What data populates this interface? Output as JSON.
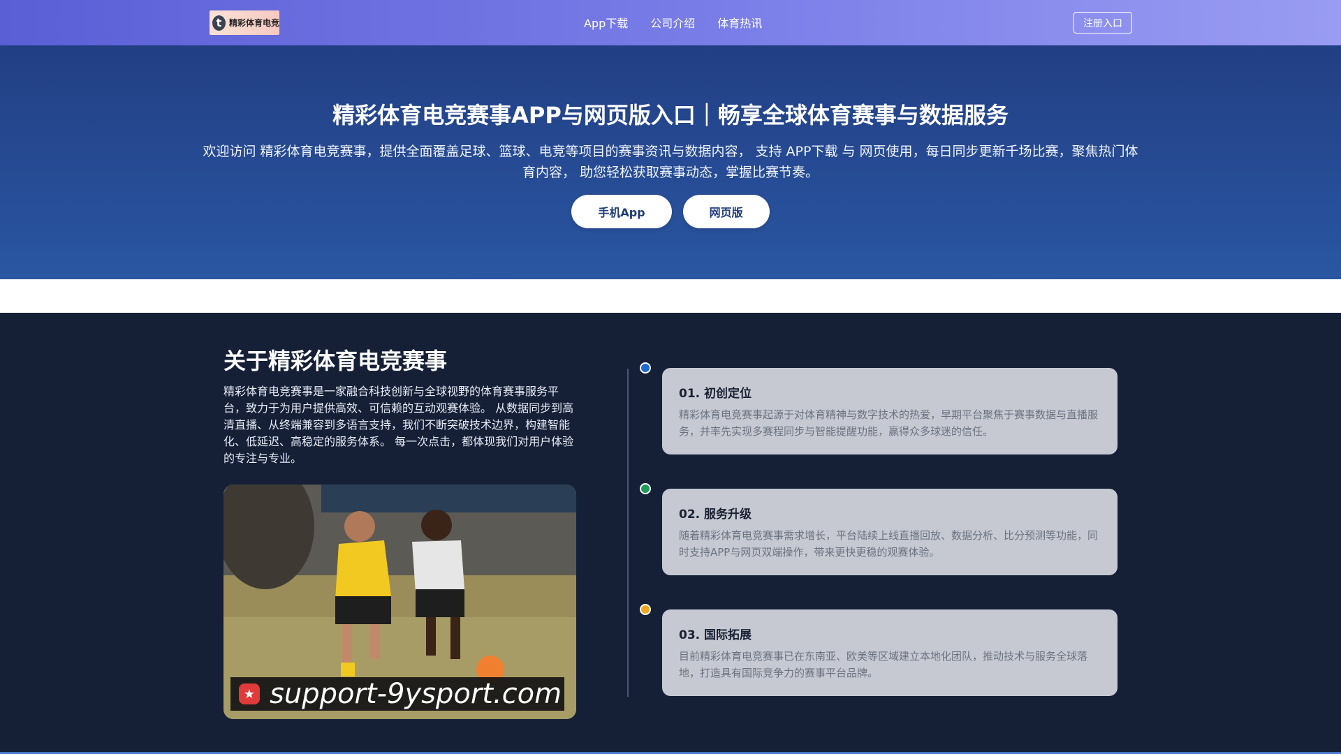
{
  "header": {
    "logo_mark": "t",
    "logo_text": "精彩体育电竞",
    "nav": [
      "App下载",
      "公司介绍",
      "体育热讯"
    ],
    "register_label": "注册入口"
  },
  "hero": {
    "title": "精彩体育电竞赛事APP与网页版入口｜畅享全球体育赛事与数据服务",
    "desc": "欢迎访问 精彩体育电竞赛事，提供全面覆盖足球、篮球、电竞等项目的赛事资讯与数据内容， 支持 APP下载 与 网页使用，每日同步更新千场比赛，聚焦热门体育内容， 助您轻松获取赛事动态，掌握比赛节奏。",
    "buttons": [
      "手机App",
      "网页版"
    ]
  },
  "about": {
    "title": "关于精彩体育电竞赛事",
    "text": "精彩体育电竞赛事是一家融合科技创新与全球视野的体育赛事服务平台，致力于为用户提供高效、可信赖的互动观赛体验。 从数据同步到高清直播、从终端兼容到多语言支持，我们不断突破技术边界，构建智能化、低延迟、高稳定的服务体系。 每一次点击，都体现我们对用户体验的专注与专业。",
    "watermark_text": "support-9ysport.com"
  },
  "timeline": [
    {
      "title": "01. 初创定位",
      "text": "精彩体育电竞赛事起源于对体育精神与数字技术的热爱，早期平台聚焦于赛事数据与直播服务，并率先实现多赛程同步与智能提醒功能，赢得众多球迷的信任。",
      "dot_color": "#1f66d6"
    },
    {
      "title": "02. 服务升级",
      "text": "随着精彩体育电竞赛事需求增长，平台陆续上线直播回放、数据分析、比分预测等功能，同时支持APP与网页双端操作，带来更快更稳的观赛体验。",
      "dot_color": "#1f9a5a"
    },
    {
      "title": "03. 国际拓展",
      "text": "目前精彩体育电竞赛事已在东南亚、欧美等区域建立本地化团队，推动技术与服务全球落地，打造具有国际竞争力的赛事平台品牌。",
      "dot_color": "#f0a81c"
    }
  ]
}
